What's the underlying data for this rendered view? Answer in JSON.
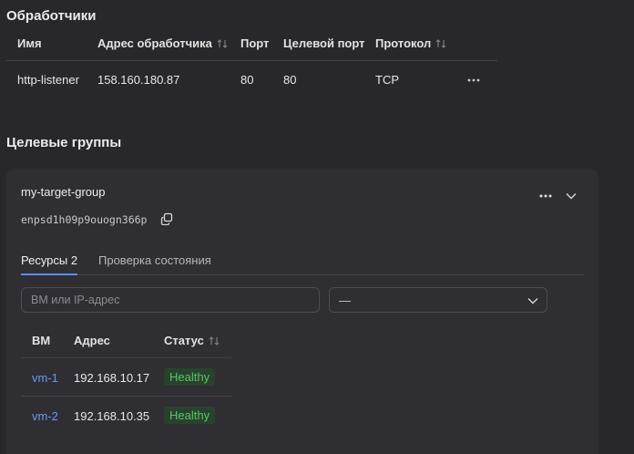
{
  "listeners": {
    "title": "Обработчики",
    "columns": {
      "name": "Имя",
      "address": "Адрес обработчика",
      "port": "Порт",
      "target_port": "Целевой порт",
      "protocol": "Протокол"
    },
    "rows": [
      {
        "name": "http-listener",
        "address": "158.160.180.87",
        "port": "80",
        "target_port": "80",
        "protocol": "TCP"
      }
    ]
  },
  "target_groups": {
    "title": "Целевые группы",
    "group": {
      "name": "my-target-group",
      "id": "enpsd1h09p9ouogn366p",
      "tabs": [
        {
          "label": "Ресурсы 2",
          "active": true
        },
        {
          "label": "Проверка состояния",
          "active": false
        }
      ],
      "search_placeholder": "ВМ или IP-адрес",
      "filter_value": "—",
      "columns": {
        "vm": "ВМ",
        "address": "Адрес",
        "status": "Статус"
      },
      "rows": [
        {
          "vm": "vm-1",
          "address": "192.168.10.17",
          "status": "Healthy"
        },
        {
          "vm": "vm-2",
          "address": "192.168.10.35",
          "status": "Healthy"
        }
      ]
    }
  },
  "colors": {
    "background": "#28272b",
    "card": "#2f2e33",
    "link": "#6d97f2",
    "healthy_text": "#59c466",
    "healthy_bg": "#29422d",
    "active_tab": "#5b8ef0"
  }
}
